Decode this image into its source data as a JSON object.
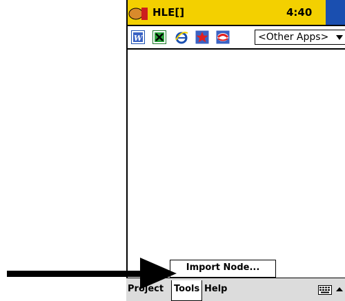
{
  "titlebar": {
    "title": "HLE[]",
    "clock": "4:40"
  },
  "toolbar": {
    "icons": [
      "word-icon",
      "excel-icon",
      "internet-explorer-icon",
      "favorites-star-icon",
      "sync-icon"
    ],
    "apps_select": "<Other Apps>"
  },
  "popup": {
    "item": "Import Node..."
  },
  "menubar": {
    "project": "Project",
    "tools": "Tools",
    "help": "Help"
  },
  "colors": {
    "titlebar": "#f3d000",
    "menubar": "#dcdcdc",
    "accent_blue": "#1a4fb0"
  }
}
